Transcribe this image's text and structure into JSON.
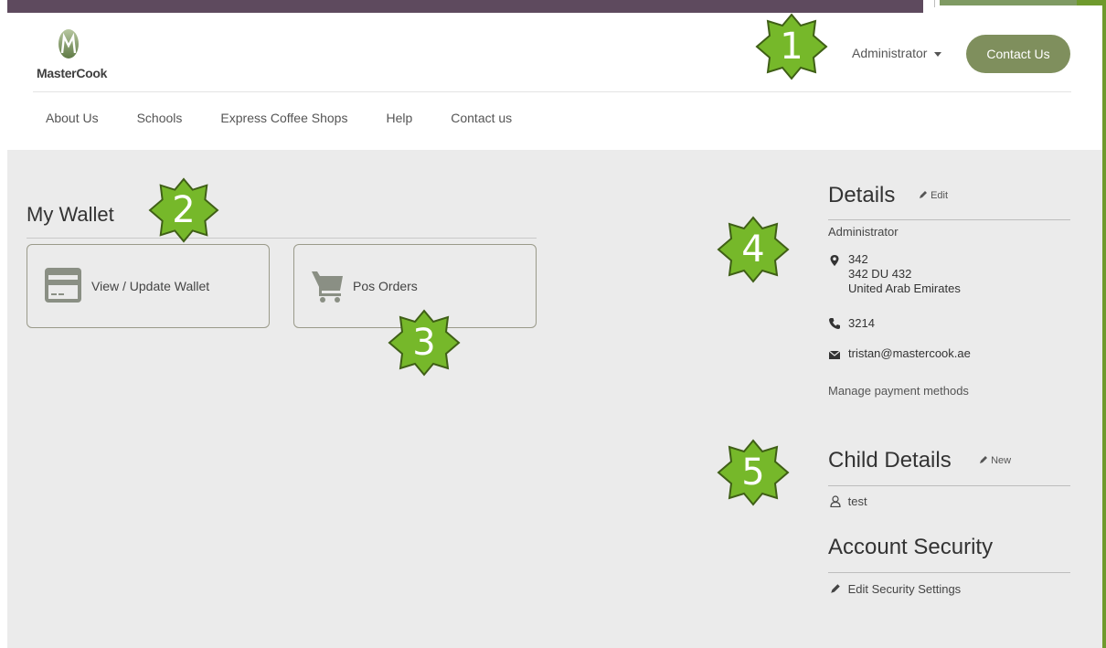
{
  "brand": {
    "logo_text": "MasterCook"
  },
  "header": {
    "admin_label": "Administrator",
    "contact_button": "Contact Us"
  },
  "nav": [
    "About Us",
    "Schools",
    "Express Coffee Shops",
    "Help",
    "Contact us"
  ],
  "wallet": {
    "title": "My Wallet",
    "cards": [
      {
        "label": "View / Update Wallet",
        "icon": "credit-card-icon"
      },
      {
        "label": "Pos Orders",
        "icon": "shopping-cart-icon"
      }
    ]
  },
  "details": {
    "title": "Details",
    "edit_label": "Edit",
    "name": "Administrator",
    "address_lines": [
      "342",
      "342 DU 432",
      "United Arab Emirates"
    ],
    "phone": "3214",
    "email": "tristan@mastercook.ae",
    "manage_link": "Manage payment methods"
  },
  "child_details": {
    "title": "Child Details",
    "new_label": "New",
    "children": [
      "test"
    ]
  },
  "account_security": {
    "title": "Account Security",
    "edit_link": "Edit Security Settings"
  },
  "annotations": [
    "1",
    "2",
    "3",
    "4",
    "5"
  ],
  "colors": {
    "brand_green": "#7f8f5d",
    "badge_green": "#76b82a",
    "top_bar": "#5e4a5e",
    "page_bg": "#ebebeb"
  }
}
